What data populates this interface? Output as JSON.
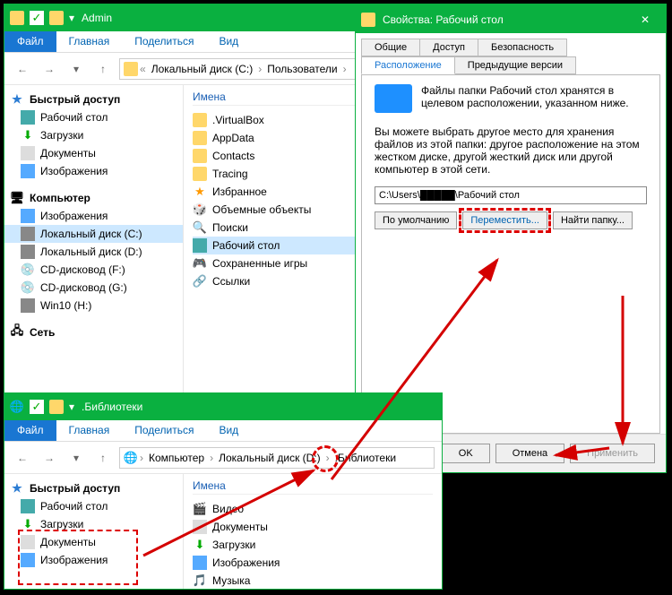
{
  "win1": {
    "title": "Admin",
    "ribbon": {
      "file": "Файл",
      "home": "Главная",
      "share": "Поделиться",
      "view": "Вид"
    },
    "addr": {
      "root": "Локальный диск (C:)",
      "users": "Пользователи"
    },
    "nav": {
      "quick": "Быстрый доступ",
      "desktop": "Рабочий стол",
      "downloads": "Загрузки",
      "documents": "Документы",
      "pictures": "Изображения",
      "computer": "Компьютер",
      "pictures2": "Изображения",
      "diskC": "Локальный диск (C:)",
      "diskD": "Локальный диск (D:)",
      "cdF": "CD-дисковод (F:)",
      "cdG": "CD-дисковод (G:)",
      "win10": "Win10 (H:)",
      "network": "Сеть"
    },
    "content": {
      "header": "Имена",
      "items": [
        ".VirtualBox",
        "AppData",
        "Contacts",
        "Tracing",
        "Избранное",
        "Объемные объекты",
        "Поиски",
        "Рабочий стол",
        "Сохраненные игры",
        "Ссылки"
      ]
    }
  },
  "dialog": {
    "title": "Свойства: Рабочий стол",
    "tabs": {
      "general": "Общие",
      "access": "Доступ",
      "security": "Безопасность",
      "location": "Расположение",
      "prev": "Предыдущие версии"
    },
    "line1": "Файлы папки Рабочий стол хранятся в целевом расположении, указанном ниже.",
    "line2": "Вы можете выбрать другое место для хранения файлов из этой папки: другое расположение на этом жестком диске, другой жесткий диск или другой компьютер в этой сети.",
    "path": "C:\\Users\\█████\\Рабочий стол",
    "btns": {
      "default": "По умолчанию",
      "move": "Переместить...",
      "find": "Найти папку..."
    },
    "footer": {
      "ok": "OK",
      "cancel": "Отмена",
      "apply": "Применить"
    }
  },
  "win2": {
    "title": ".Библиотеки",
    "ribbon": {
      "file": "Файл",
      "home": "Главная",
      "share": "Поделиться",
      "view": "Вид"
    },
    "addr": {
      "pc": "Компьютер",
      "diskD": "Локальный диск (D:)",
      "lib": ".Библиотеки"
    },
    "nav": {
      "quick": "Быстрый доступ",
      "desktop": "Рабочий стол",
      "downloads": "Загрузки",
      "documents": "Документы",
      "pictures": "Изображения"
    },
    "content": {
      "header": "Имена",
      "items": [
        "Видео",
        "Документы",
        "Загрузки",
        "Изображения",
        "Музыка"
      ]
    }
  }
}
